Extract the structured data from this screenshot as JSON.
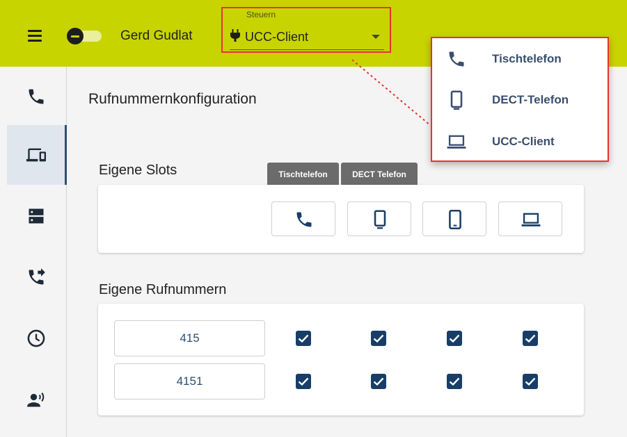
{
  "header": {
    "user_name": "Gerd Gudlat",
    "device_select": {
      "label": "Steuern",
      "value": "UCC-Client",
      "icon": "plug-icon"
    },
    "accent_color": "#c8d400"
  },
  "device_menu": {
    "options": [
      {
        "label": "Tischtelefon",
        "icon": "phone-icon"
      },
      {
        "label": "DECT-Telefon",
        "icon": "dect-phone-icon"
      },
      {
        "label": "UCC-Client",
        "icon": "laptop-icon"
      }
    ]
  },
  "sidebar": {
    "items": [
      {
        "name": "calls",
        "icon": "phone-icon"
      },
      {
        "name": "devices",
        "icon": "devices-icon",
        "active": true
      },
      {
        "name": "storage",
        "icon": "storage-icon"
      },
      {
        "name": "call-forwarding",
        "icon": "phone-forward-icon"
      },
      {
        "name": "history",
        "icon": "clock-icon"
      },
      {
        "name": "presence",
        "icon": "person-speaking-icon"
      }
    ]
  },
  "main": {
    "title": "Rufnummernkonfiguration",
    "slots": {
      "title": "Eigene Slots",
      "tooltips": [
        "Tischtelefon",
        "DECT Telefon"
      ],
      "buttons": [
        "phone-icon",
        "dect-phone-icon",
        "mobile-icon",
        "laptop-icon"
      ]
    },
    "numbers": {
      "title": "Eigene Rufnummern",
      "rows": [
        {
          "number": "415",
          "checked": [
            true,
            true,
            true,
            true
          ]
        },
        {
          "number": "4151",
          "checked": [
            true,
            true,
            true,
            true
          ]
        }
      ]
    }
  }
}
